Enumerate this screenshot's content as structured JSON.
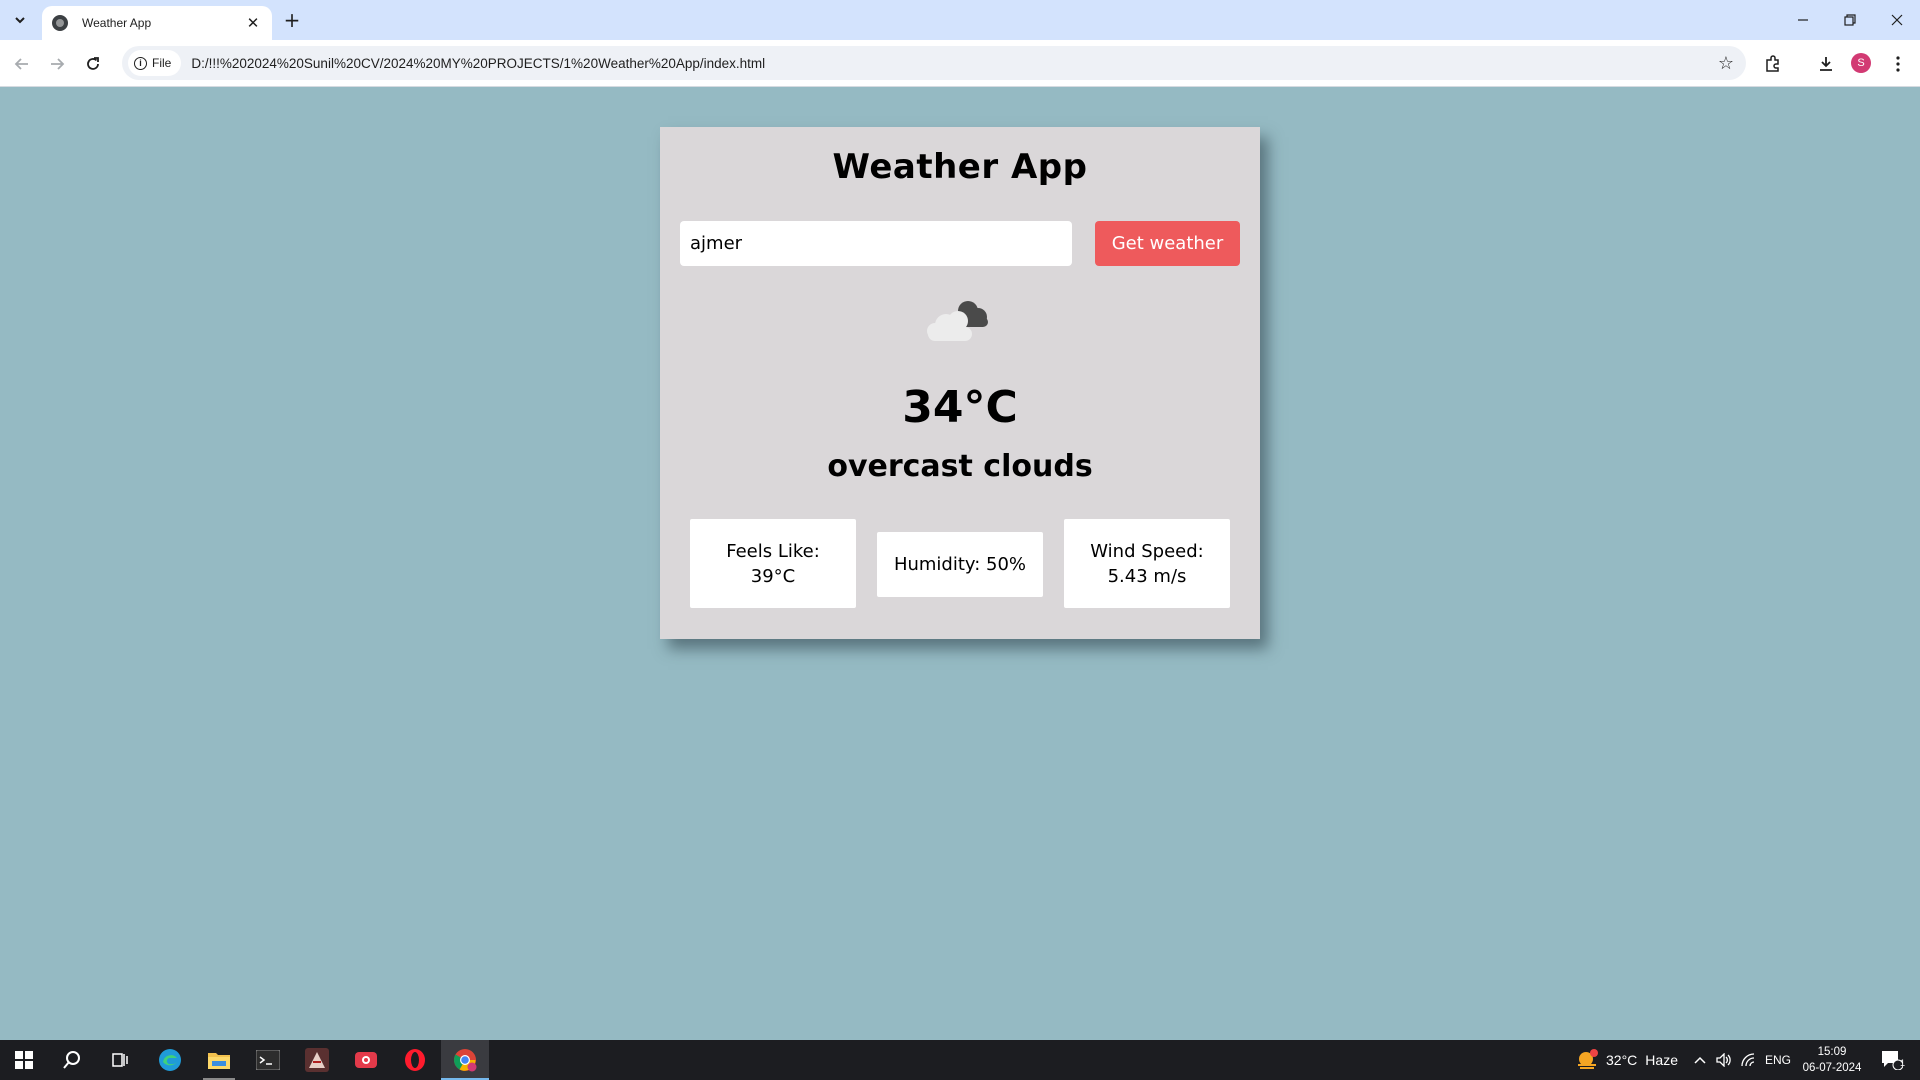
{
  "browser": {
    "tab_title": "Weather App",
    "chip_label": "File",
    "url": "D:/!!!%202024%20Sunil%20CV/2024%20MY%20PROJECTS/1%20Weather%20App/index.html",
    "profile_initial": "S"
  },
  "app": {
    "title": "Weather App",
    "city_value": "ajmer",
    "button_label": "Get weather",
    "icon": "overcast-clouds-icon",
    "temperature": "34°C",
    "description": "overcast clouds",
    "details": {
      "feels_like_label": "Feels Like:",
      "feels_like_value": "39°C",
      "humidity": "Humidity: 50%",
      "wind_label": "Wind Speed:",
      "wind_value": "5.43 m/s"
    }
  },
  "taskbar": {
    "weather_temp": "32°C",
    "weather_desc": "Haze",
    "weather_alert_count": "1",
    "language": "ENG",
    "time": "15:09",
    "date": "06-07-2024",
    "notification_count": "1"
  },
  "colors": {
    "page_bg": "#95bac3",
    "card_bg": "#dad7d9",
    "button_bg": "#ee5a5c",
    "tabstrip_bg": "#d3e3fd",
    "taskbar_bg": "#1c1d21"
  }
}
